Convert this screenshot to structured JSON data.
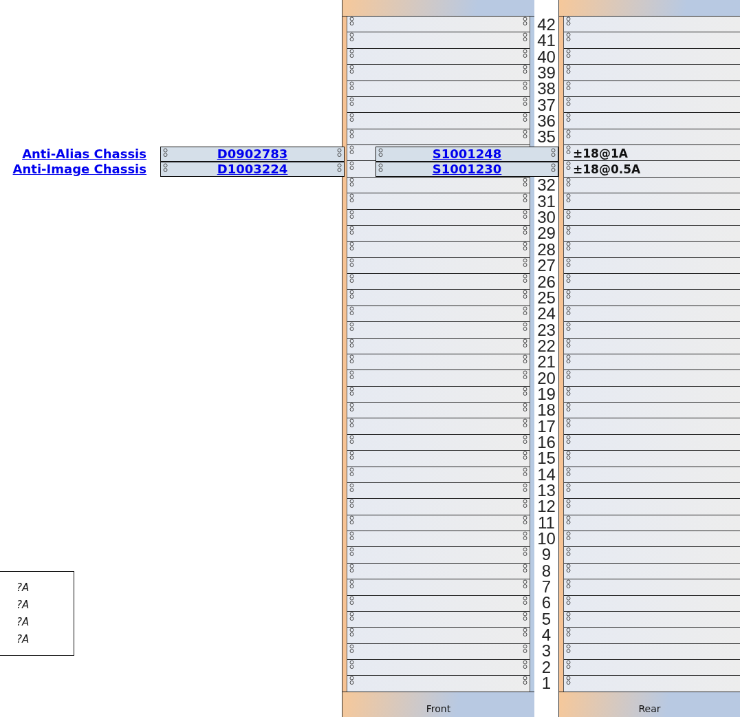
{
  "racks": [
    {
      "label": "Front"
    },
    {
      "label": "Rear"
    }
  ],
  "units": [
    {
      "kind": "number",
      "label": "42"
    },
    {
      "kind": "number",
      "label": "41"
    },
    {
      "kind": "number",
      "label": "40"
    },
    {
      "kind": "number",
      "label": "39"
    },
    {
      "kind": "number",
      "label": "38"
    },
    {
      "kind": "number",
      "label": "37"
    },
    {
      "kind": "number",
      "label": "36"
    },
    {
      "kind": "number",
      "label": "35"
    },
    {
      "kind": "hidden"
    },
    {
      "kind": "hidden"
    },
    {
      "kind": "number",
      "label": "32"
    },
    {
      "kind": "number",
      "label": "31"
    },
    {
      "kind": "number",
      "label": "30"
    },
    {
      "kind": "number",
      "label": "29"
    },
    {
      "kind": "number",
      "label": "28"
    },
    {
      "kind": "number",
      "label": "27"
    },
    {
      "kind": "number",
      "label": "26"
    },
    {
      "kind": "number",
      "label": "25"
    },
    {
      "kind": "number",
      "label": "24"
    },
    {
      "kind": "number",
      "label": "23"
    },
    {
      "kind": "number",
      "label": "22"
    },
    {
      "kind": "number",
      "label": "21"
    },
    {
      "kind": "number",
      "label": "20"
    },
    {
      "kind": "number",
      "label": "19"
    },
    {
      "kind": "number",
      "label": "18"
    },
    {
      "kind": "number",
      "label": "17"
    },
    {
      "kind": "number",
      "label": "16"
    },
    {
      "kind": "number",
      "label": "15"
    },
    {
      "kind": "number",
      "label": "14"
    },
    {
      "kind": "number",
      "label": "13"
    },
    {
      "kind": "number",
      "label": "12"
    },
    {
      "kind": "number",
      "label": "11"
    },
    {
      "kind": "number",
      "label": "10"
    },
    {
      "kind": "number",
      "label": "9"
    },
    {
      "kind": "number",
      "label": "8"
    },
    {
      "kind": "number",
      "label": "7"
    },
    {
      "kind": "number",
      "label": "6"
    },
    {
      "kind": "number",
      "label": "5"
    },
    {
      "kind": "number",
      "label": "4"
    },
    {
      "kind": "number",
      "label": "3"
    },
    {
      "kind": "number",
      "label": "2"
    },
    {
      "kind": "number",
      "label": "1"
    }
  ],
  "devices": [
    {
      "name": "Anti-Alias Chassis",
      "front": "D0902783",
      "rear": "S1001248",
      "power": "±18@1A"
    },
    {
      "name": "Anti-Image Chassis",
      "front": "D1003224",
      "rear": "S1001230",
      "power": "±18@0.5A"
    }
  ],
  "legend": [
    "?A",
    "?A",
    "?A",
    "?A"
  ]
}
